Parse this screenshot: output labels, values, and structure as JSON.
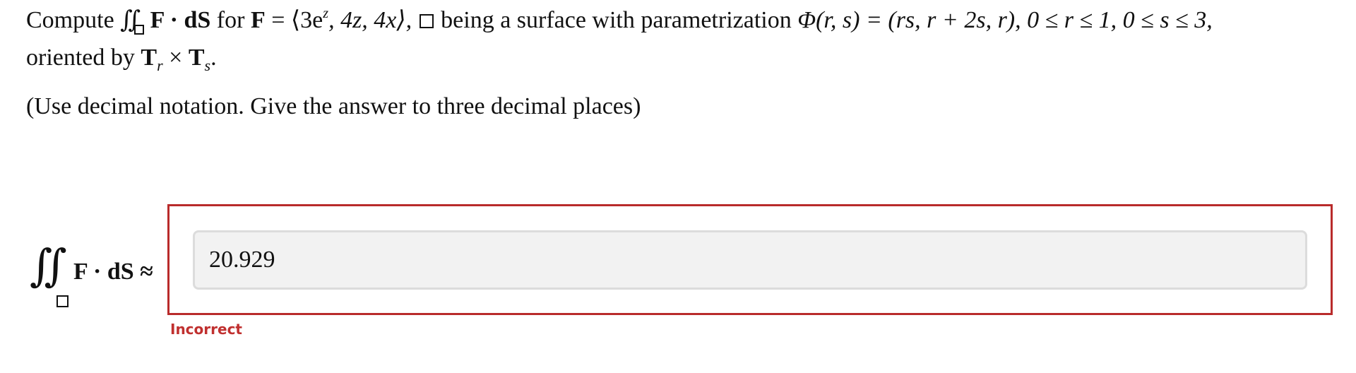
{
  "problem": {
    "compute_word": "Compute",
    "integral_symbol": "∬",
    "integrand": "F · dS",
    "for_word": "for",
    "field_name": "F",
    "field_expression": "= ⟨3e",
    "field_exponent": "z",
    "field_rest": ", 4z, 4x⟩,",
    "surface_text": "being a surface with parametrization",
    "param_expression": "Φ(r, s) = (rs, r + 2s, r), 0 ≤ r ≤ 1, 0 ≤ s ≤ 3,",
    "orientation_text": "oriented by",
    "tangent_1": "T",
    "tangent_1_sub": "r",
    "cross": "×",
    "tangent_2": "T",
    "tangent_2_sub": "s",
    "period": "."
  },
  "instructions": "(Use decimal notation. Give the answer to three decimal places)",
  "answer": {
    "label_integral": "∬",
    "label_expression": "F · dS ≈",
    "value": "20.929",
    "status": "Incorrect",
    "status_color": "#c0302f",
    "frame_color": "#b92b2b"
  }
}
